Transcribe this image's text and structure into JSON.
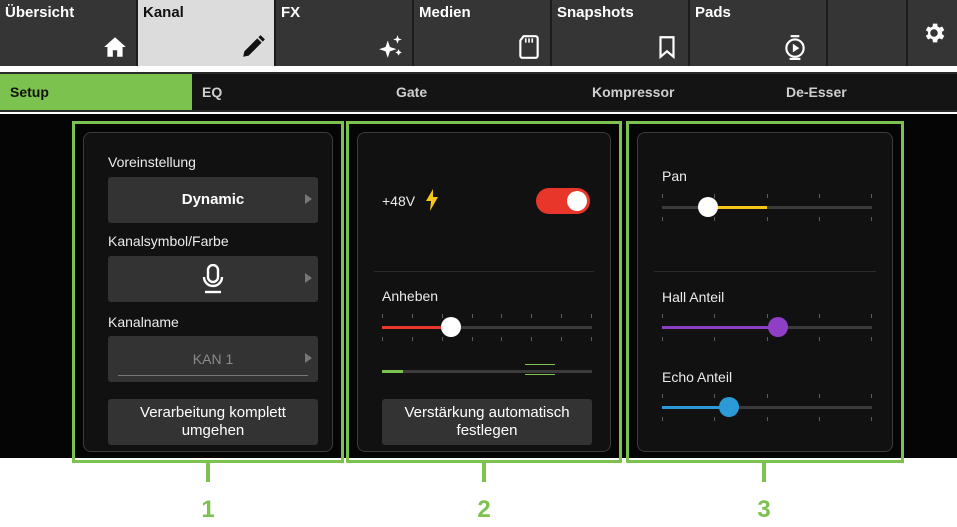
{
  "nav": {
    "tabs": [
      {
        "label": "Übersicht",
        "icon": "home-icon"
      },
      {
        "label": "Kanal",
        "icon": "pencil-icon",
        "active": true
      },
      {
        "label": "FX",
        "icon": "sparkle-icon"
      },
      {
        "label": "Medien",
        "icon": "sd-card-icon"
      },
      {
        "label": "Snapshots",
        "icon": "bookmark-icon"
      },
      {
        "label": "Pads",
        "icon": "pad-play-icon"
      }
    ],
    "settings_icon": "gear-icon"
  },
  "subnav": {
    "tabs": [
      {
        "label": "Setup",
        "active": true
      },
      {
        "label": "EQ"
      },
      {
        "label": "Gate"
      },
      {
        "label": "Kompressor"
      },
      {
        "label": "De-Esser"
      }
    ]
  },
  "panel1": {
    "preset_label": "Voreinstellung",
    "preset_value": "Dynamic",
    "symbol_label": "Kanalsymbol/Farbe",
    "symbol_icon": "microphone-icon",
    "name_label": "Kanalname",
    "name_value": "KAN 1",
    "bypass_button": "Verarbeitung komplett umgehen"
  },
  "panel2": {
    "phantom_label": "+48V",
    "phantom_icon": "lightning-icon",
    "phantom_on": true,
    "gain_label": "Anheben",
    "gain_position": 0.33,
    "meter_level": 0.1,
    "auto_gain_button": "Verstärkung automatisch festlegen"
  },
  "panel3": {
    "pan_label": "Pan",
    "pan_position": 0.22,
    "reverb_label": "Hall Anteil",
    "reverb_position": 0.55,
    "echo_label": "Echo Anteil",
    "echo_position": 0.32
  },
  "callouts": [
    "1",
    "2",
    "3"
  ],
  "colors": {
    "accent": "#7cc24e",
    "toggle_on": "#e8362b",
    "phantom_bolt": "#f5c518",
    "pan_fill": "#f5c518",
    "gain_fill": "#e8362b",
    "reverb_fill": "#8e3fc5",
    "echo_fill": "#2b9bd8"
  }
}
